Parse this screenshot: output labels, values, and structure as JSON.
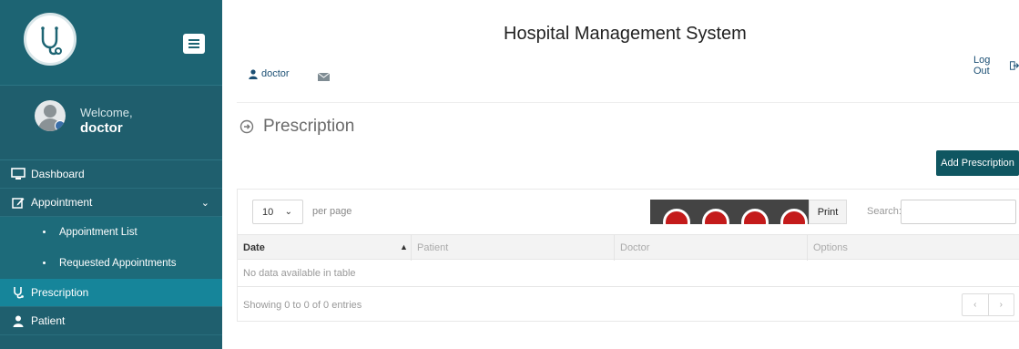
{
  "app": {
    "title": "Hospital Management System"
  },
  "topbar": {
    "username": "doctor",
    "logout_label": "Log Out"
  },
  "sidebar": {
    "welcome_label": "Welcome,",
    "user_name": "doctor",
    "items": [
      {
        "label": "Dashboard",
        "icon": "monitor-icon"
      },
      {
        "label": "Appointment",
        "icon": "edit-icon",
        "expanded": true
      },
      {
        "label": "Appointment List",
        "sub": true
      },
      {
        "label": "Requested Appointments",
        "sub": true
      },
      {
        "label": "Prescription",
        "icon": "stethoscope-icon",
        "active": true
      },
      {
        "label": "Patient",
        "icon": "user-icon"
      }
    ]
  },
  "page": {
    "heading": "Prescription",
    "add_button": "Add Prescription"
  },
  "table": {
    "page_length": "10",
    "per_page_label": "per page",
    "print_label": "Print",
    "search_label": "Search:",
    "search_value": "",
    "columns": [
      "Date",
      "Patient",
      "Doctor",
      "Options"
    ],
    "sorted_column": "Date",
    "empty_message": "No data available in table",
    "info": "Showing 0 to 0 of 0 entries",
    "prev_label": "‹",
    "next_label": "›"
  },
  "colors": {
    "sidebar": "#1f5f6e",
    "active": "#16859a",
    "button": "#0f5661",
    "link": "#1b4f74"
  }
}
